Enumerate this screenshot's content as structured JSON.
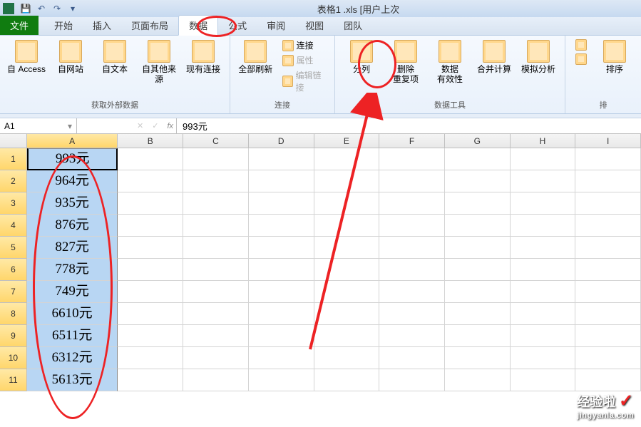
{
  "title_bar": {
    "app_title": "表格1 .xls [用户上次"
  },
  "qat": {
    "save": "💾",
    "undo": "↶",
    "redo": "↷",
    "more": "▾"
  },
  "tabs": {
    "file": "文件",
    "items": [
      "开始",
      "插入",
      "页面布局",
      "数据",
      "公式",
      "审阅",
      "视图",
      "团队"
    ],
    "active_index": 3
  },
  "ribbon": {
    "get_external": {
      "label": "获取外部数据",
      "btns": [
        "自 Access",
        "自网站",
        "自文本",
        "自其他来源",
        "现有连接"
      ]
    },
    "connections": {
      "label": "连接",
      "refresh": "全部刷新",
      "conn": "连接",
      "props": "属性",
      "edit_links": "编辑链接"
    },
    "data_tools": {
      "label": "数据工具",
      "btns": [
        "分列",
        "删除\n重复项",
        "数据\n有效性",
        "合并计算",
        "模拟分析"
      ]
    },
    "sort": {
      "label": "排",
      "sort_btn": "排序"
    }
  },
  "name_box": {
    "value": "A1"
  },
  "formula_bar": {
    "fx": "fx",
    "value": "993元"
  },
  "columns": [
    "A",
    "B",
    "C",
    "D",
    "E",
    "F",
    "G",
    "H",
    "I"
  ],
  "rows": [
    {
      "n": "1",
      "A": "993元"
    },
    {
      "n": "2",
      "A": "964元"
    },
    {
      "n": "3",
      "A": "935元"
    },
    {
      "n": "4",
      "A": "876元"
    },
    {
      "n": "5",
      "A": "827元"
    },
    {
      "n": "6",
      "A": "778元"
    },
    {
      "n": "7",
      "A": "749元"
    },
    {
      "n": "8",
      "A": "6610元"
    },
    {
      "n": "9",
      "A": "6511元"
    },
    {
      "n": "10",
      "A": "6312元"
    },
    {
      "n": "11",
      "A": "5613元"
    }
  ],
  "watermark": {
    "brand": "经验啦",
    "url": "jingyanla.com"
  }
}
